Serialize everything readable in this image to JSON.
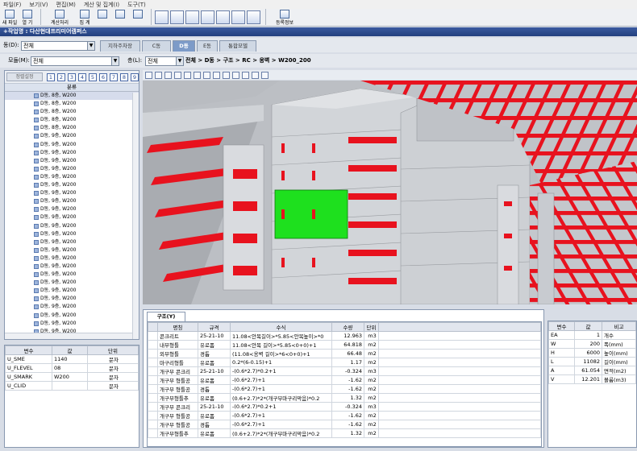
{
  "menu": [
    "파일(F)",
    "보기(V)",
    "편집(M)",
    "계산 및 집계(I)",
    "도구(T)"
  ],
  "toolbar": {
    "new_label": "새 파일",
    "open_label": "열 기",
    "calc_label": "계산처리",
    "sum_label": "집 계",
    "info_label": "등록정보"
  },
  "title": "+작업명 : 다산현대프리미어캠퍼스",
  "building": {
    "label": "동(D):",
    "value": "전체",
    "tabs": [
      "지하주차장",
      "C동",
      "D동",
      "E동",
      "통합모델"
    ],
    "active_tab": "D동"
  },
  "module": {
    "label": "모듈(M):",
    "value": "전체",
    "floor_label": "층(L):",
    "floor_value": "전체"
  },
  "breadcrumb": "전체 > D동 > 구조 > RC > 옹벽 > W200_200",
  "sort": {
    "button": "정렬설정",
    "levels": [
      "1",
      "2",
      "3",
      "4",
      "5",
      "6",
      "7",
      "8",
      "9"
    ]
  },
  "tree": {
    "header": "분류",
    "items": [
      "D동, 8층, W200",
      "D동, 8층, W200",
      "D동, 8층, W200",
      "D동, 8층, W200",
      "D동, 8층, W200",
      "D동, 9층, W200",
      "D동, 9층, W200",
      "D동, 9층, W200",
      "D동, 9층, W200",
      "D동, 9층, W200",
      "D동, 9층, W200",
      "D동, 9층, W200",
      "D동, 9층, W200",
      "D동, 9층, W200",
      "D동, 9층, W200",
      "D동, 9층, W200",
      "D동, 9층, W200",
      "D동, 9층, W200",
      "D동, 9층, W200",
      "D동, 9층, W200",
      "D동, 9층, W200",
      "D동, 9층, W200",
      "D동, 9층, W200",
      "D동, 9층, W200",
      "D동, 9층, W200",
      "D동, 9층, W200",
      "D동, 9층, W200",
      "D동, 9층, W200",
      "D동, 9층, W200",
      "D동, 9층, W200"
    ]
  },
  "variables": {
    "headers": [
      "변수",
      "값",
      "단위"
    ],
    "rows": [
      [
        "U_SME",
        "1140",
        "문자"
      ],
      [
        "U_FLEVEL",
        "08",
        "문자"
      ],
      [
        "U_SMARK",
        "W200",
        "문자"
      ],
      [
        "U_CLID",
        "",
        "문자"
      ]
    ]
  },
  "quantity": {
    "tab": "구조(Y)",
    "headers": [
      "명칭",
      "규격",
      "수식",
      "수량",
      "단위"
    ],
    "rows": [
      [
        "콘크리트",
        "25-21-10",
        "11.08<안목길이>*5.85<안목높이>*0",
        "12.963",
        "m3"
      ],
      [
        "내부형틀",
        "유로폼",
        "11.08<안목 길이>*5.85<0+0)+1",
        "64.818",
        "m2"
      ],
      [
        "외부형틀",
        "경톱",
        "(11.08<옹벽 길이>*6<0+0)+1",
        "66.48",
        "m2"
      ],
      [
        "마구리형틀",
        "유로폼",
        "0.2*(6-0.15)+1",
        "1.17",
        "m2"
      ],
      [
        "개구부 콘크리",
        "25-21-10",
        "-(0.6*2.7)*0.2+1",
        "-0.324",
        "m3"
      ],
      [
        "개구부 형틀공",
        "유로폼",
        "-(0.6*2.7)+1",
        "-1.62",
        "m2"
      ],
      [
        "개구부 형틀공",
        "경톱",
        "-(0.6*2.7)+1",
        "-1.62",
        "m2"
      ],
      [
        "개구부형틀추",
        "유로폼",
        "(0.6+2.7)*2*(개구부마구리막음)*0.2",
        "1.32",
        "m2"
      ],
      [
        "개구부 콘크리",
        "25-21-10",
        "-(0.6*2.7)*0.2+1",
        "-0.324",
        "m3"
      ],
      [
        "개구부 형틀공",
        "유로폼",
        "-(0.6*2.7)+1",
        "-1.62",
        "m2"
      ],
      [
        "개구부 형틀공",
        "경톱",
        "-(0.6*2.7)+1",
        "-1.62",
        "m2"
      ],
      [
        "개구부형틀추",
        "유로폼",
        "(0.6+2.7)*2*(개구부마구리막음)*0.2",
        "1.32",
        "m2"
      ]
    ]
  },
  "properties": {
    "headers": [
      "변수",
      "값",
      "비고"
    ],
    "rows": [
      [
        "EA",
        "1",
        "개수"
      ],
      [
        "W",
        "200",
        "폭(mm)"
      ],
      [
        "H",
        "6000",
        "높이(mm)"
      ],
      [
        "L",
        "11082",
        "길이(mm)"
      ],
      [
        "A",
        "61.054",
        "면적(m2)"
      ],
      [
        "V",
        "12.201",
        "볼륨(m3)"
      ]
    ]
  },
  "colors": {
    "accent": "#23407e",
    "highlight": "#1ee01e",
    "beam": "#e8121e",
    "concrete": "#c9cdd2"
  }
}
